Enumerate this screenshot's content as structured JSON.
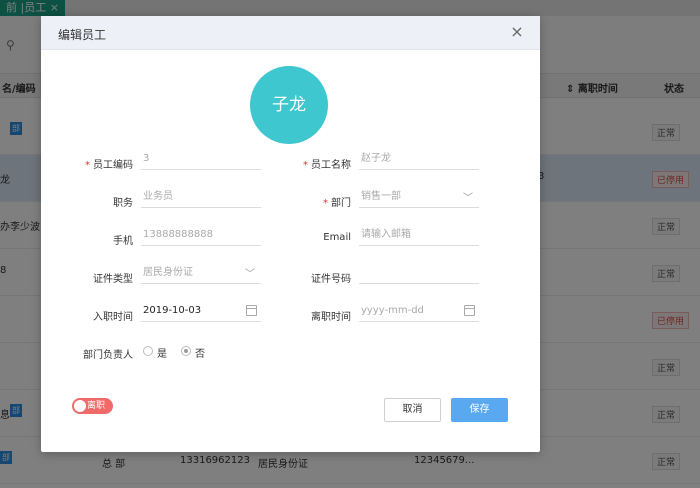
{
  "background": {
    "tab_label": "前 |员工 ×",
    "headers": [
      "名/编码",
      "离职时间",
      "状态"
    ],
    "rows": [
      {
        "name": "",
        "tag": "部",
        "date": "",
        "status": "正常"
      },
      {
        "name": "龙",
        "tag": "",
        "date": "3",
        "status": "已停用"
      },
      {
        "name": "办李少波",
        "tag": "",
        "date": "",
        "status": "正常"
      },
      {
        "name": "8",
        "tag": "",
        "date": "",
        "status": "正常"
      },
      {
        "name": "",
        "tag": "",
        "date": "",
        "status": "已停用"
      },
      {
        "name": "",
        "tag": "",
        "date": "",
        "status": "正常"
      },
      {
        "name": "息",
        "tag": "部",
        "date": "",
        "status": "正常"
      },
      {
        "name": "",
        "tag": "部",
        "date": "",
        "status": "正常"
      }
    ],
    "last_row": {
      "dept": "总 部",
      "phone": "13316962123",
      "idtype": "居民身份证",
      "idno": "12345679..."
    }
  },
  "modal": {
    "title": "编辑员工",
    "close": "×",
    "avatar_text": "子龙",
    "fields": {
      "emp_code": {
        "label": "员工编码",
        "value": "3",
        "required": true
      },
      "emp_name": {
        "label": "员工名称",
        "value": "赵子龙",
        "required": true
      },
      "position": {
        "label": "职务",
        "placeholder": "业务员"
      },
      "dept": {
        "label": "部门",
        "value": "销售一部",
        "required": true
      },
      "mobile": {
        "label": "手机",
        "placeholder": "13888888888"
      },
      "email": {
        "label": "Email",
        "placeholder": "请输入邮箱"
      },
      "id_type": {
        "label": "证件类型",
        "placeholder": "居民身份证"
      },
      "id_no": {
        "label": "证件号码",
        "value": ""
      },
      "hire_date": {
        "label": "入职时间",
        "value": "2019-10-03"
      },
      "leave_date": {
        "label": "离职时间",
        "placeholder": "yyyy-mm-dd"
      },
      "dept_head": {
        "label": "部门负责人",
        "options": [
          "是",
          "否"
        ],
        "selected": "否"
      }
    },
    "toggle_label": "离职",
    "cancel_label": "取消",
    "save_label": "保存",
    "required_mark": "*"
  },
  "colors": {
    "avatar": "#3ec7ce",
    "save": "#5aa8f0",
    "toggle": "#f06a6a",
    "required": "#e03030"
  }
}
